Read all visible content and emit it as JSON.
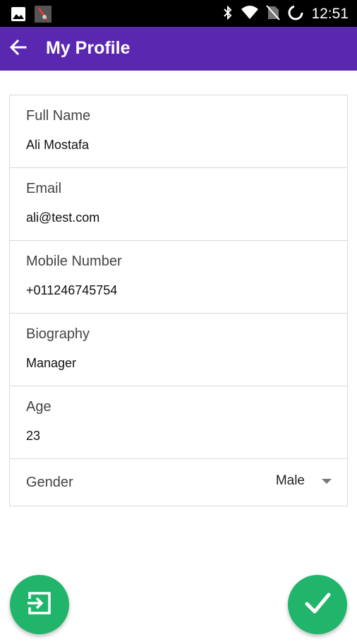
{
  "status_bar": {
    "time": "12:51"
  },
  "app_bar": {
    "title": "My Profile"
  },
  "fields": [
    {
      "label": "Full Name",
      "value": "Ali Mostafa"
    },
    {
      "label": "Email",
      "value": "ali@test.com"
    },
    {
      "label": "Mobile Number",
      "value": "+011246745754"
    },
    {
      "label": "Biography",
      "value": "Manager"
    },
    {
      "label": "Age",
      "value": "23"
    }
  ],
  "gender": {
    "label": "Gender",
    "selected": "Male"
  },
  "colors": {
    "app_bar": "#5a28b0",
    "fab": "#21b56b",
    "status_bar": "#000000"
  },
  "icons": {
    "back": "arrow-left-icon",
    "logout": "exit-icon",
    "save": "check-icon"
  }
}
